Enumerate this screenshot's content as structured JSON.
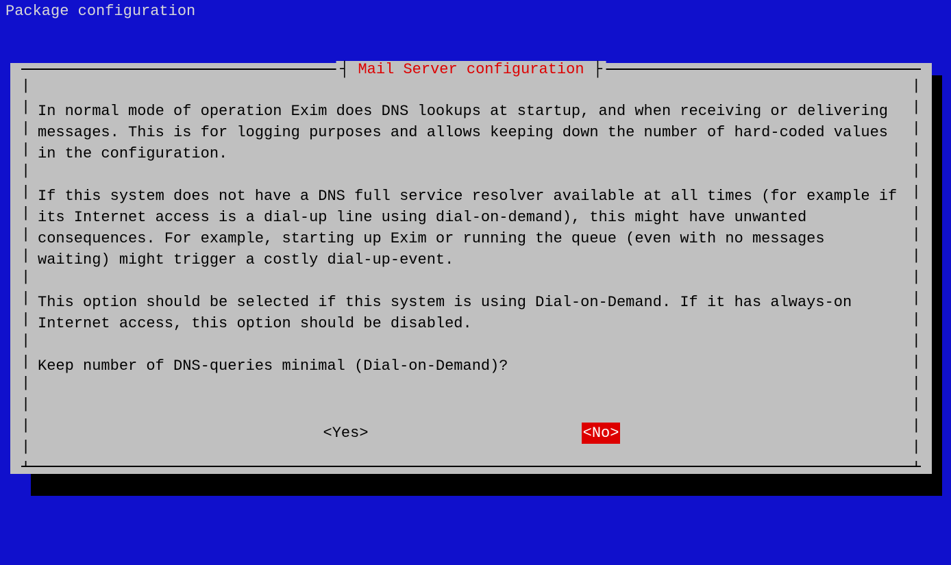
{
  "page_title": "Package configuration",
  "dialog": {
    "title": "Mail Server configuration",
    "paragraphs": [
      "In normal mode of operation Exim does DNS lookups at startup, and when receiving or delivering messages. This is for logging purposes and allows keeping down the number of hard-coded values in the configuration.",
      "If this system does not have a DNS full service resolver available at all times (for example if its Internet access is a dial-up line using dial-on-demand), this might have unwanted consequences. For example, starting up Exim or running the queue (even with no messages waiting) might trigger a costly dial-up-event.",
      "This option should be selected if this system is using Dial-on-Demand. If it has always-on Internet access, this option should be disabled.",
      "Keep number of DNS-queries minimal (Dial-on-Demand)?"
    ],
    "buttons": {
      "yes": "<Yes>",
      "no": "<No>",
      "selected": "no"
    }
  }
}
